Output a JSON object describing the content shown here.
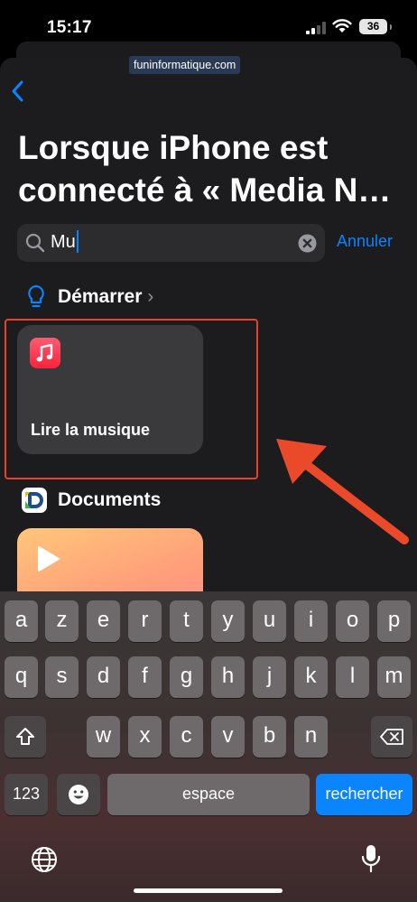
{
  "status_bar": {
    "time": "15:17",
    "battery_level": "36"
  },
  "watermark": "funinformatique.com",
  "header": {
    "title_line1": "Lorsque iPhone est",
    "title_line2": "connecté à « Media N…"
  },
  "search": {
    "value": "Mu",
    "cancel_label": "Annuler"
  },
  "sections": {
    "start": {
      "label": "Démarrer",
      "icon": "lightbulb-icon",
      "chevron": "›"
    },
    "documents": {
      "label": "Documents",
      "icon": "documents-app-icon"
    }
  },
  "actions": [
    {
      "label": "Lire la musique",
      "icon": "music-note-icon",
      "color": "#fa233b"
    }
  ],
  "keyboard": {
    "row1": [
      "a",
      "z",
      "e",
      "r",
      "t",
      "y",
      "u",
      "i",
      "o",
      "p"
    ],
    "row2": [
      "q",
      "s",
      "d",
      "f",
      "g",
      "h",
      "j",
      "k",
      "l",
      "m"
    ],
    "row3": [
      "w",
      "x",
      "c",
      "v",
      "b",
      "n"
    ],
    "numbers_label": "123",
    "space_label": "espace",
    "return_label": "rechercher"
  },
  "colors": {
    "accent": "#0a84ff",
    "highlight": "#e5432c",
    "background": "#1c1c1e"
  }
}
